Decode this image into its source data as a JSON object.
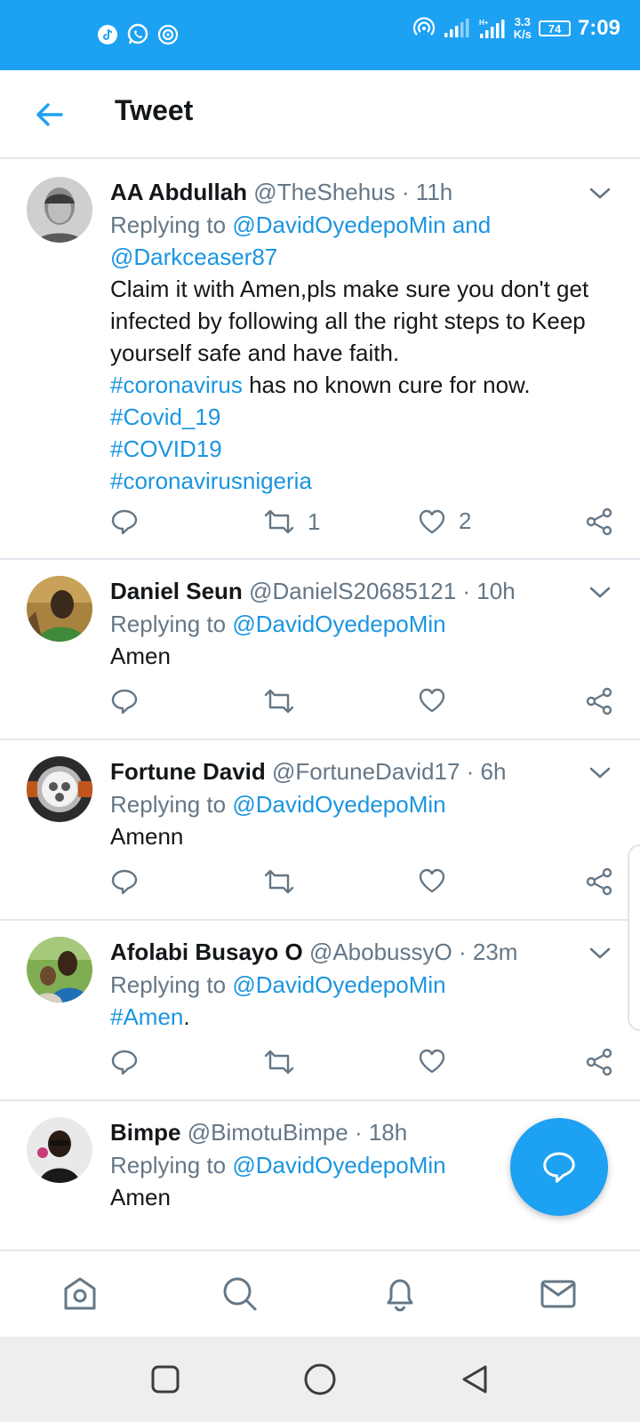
{
  "status_bar": {
    "speed_value": "3.3",
    "speed_unit": "K/s",
    "battery": "74",
    "time": "7:09",
    "icons": [
      "tiktok-icon",
      "whatsapp-icon",
      "hotspot-icon",
      "signal-icon",
      "signal-icon"
    ]
  },
  "header": {
    "title": "Tweet"
  },
  "tweets": [
    {
      "name": "AA Abdullah",
      "handle": "@TheShehus",
      "sep": " · ",
      "time": "11h",
      "replying_prefix": "Replying to ",
      "replying_to": "@DavidOyedepoMin and",
      "replying_to_2": "@Darkceaser87",
      "text_1": "Claim it with Amen,pls make sure you don't get infected by following all the right steps to Keep yourself safe and have faith.",
      "tag_1": "#coronavirus",
      "text_2": " has no known cure for now.",
      "tag_2": "#Covid_19",
      "tag_3": "#COVID19",
      "tag_4": "#coronavirusnigeria",
      "retweets": "1",
      "likes": "2"
    },
    {
      "name": "Daniel Seun",
      "handle": "@DanielS20685121",
      "sep": " · ",
      "time": "10h",
      "replying_prefix": "Replying to ",
      "replying_to": "@DavidOyedepoMin",
      "text": "Amen"
    },
    {
      "name": "Fortune David",
      "handle": "@FortuneDavid17",
      "sep": " · ",
      "time": "6h",
      "replying_prefix": "Replying to ",
      "replying_to": "@DavidOyedepoMin",
      "text": "Amenn"
    },
    {
      "name": "Afolabi Busayo O",
      "handle": "@AbobussyO",
      "sep": " · ",
      "time": "23m",
      "replying_prefix": "Replying to ",
      "replying_to": "@DavidOyedepoMin",
      "tag": "#Amen",
      "text": "."
    },
    {
      "name": "Bimpe",
      "handle": "@BimotuBimpe",
      "sep": " · ",
      "time": "18h",
      "replying_prefix": "Replying to ",
      "replying_to": "@DavidOyedepoMin",
      "text": "Amen"
    }
  ],
  "tabs": [
    "home-icon",
    "search-icon",
    "bell-icon",
    "mail-icon"
  ],
  "nav": [
    "recents-icon",
    "home-circle-icon",
    "back-triangle-icon"
  ],
  "colors": {
    "accent": "#1da1f2",
    "link": "#1b95e0",
    "text": "#14171a",
    "muted": "#657786",
    "divider": "#e1e8ed"
  }
}
